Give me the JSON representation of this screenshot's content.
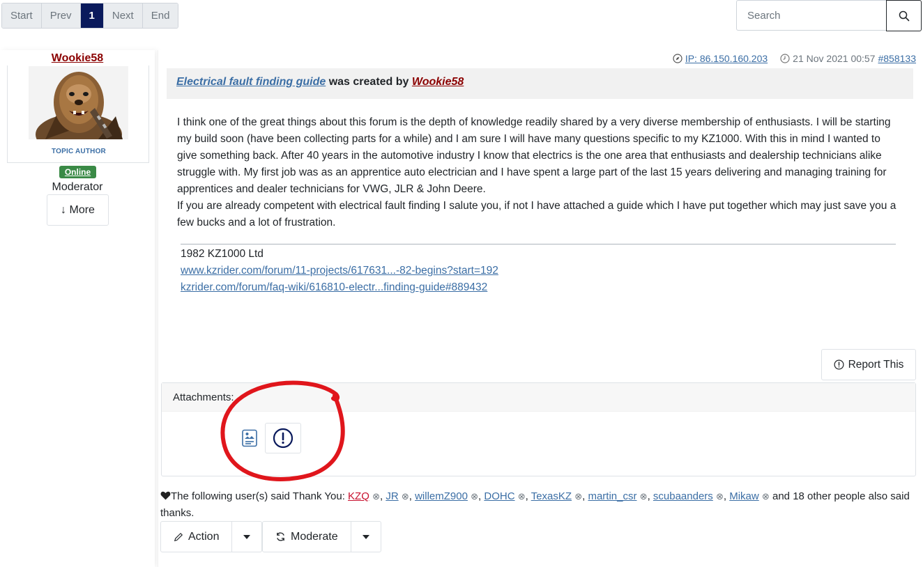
{
  "pagination": {
    "start": "Start",
    "prev": "Prev",
    "current": "1",
    "next": "Next",
    "end": "End"
  },
  "search": {
    "placeholder": "Search"
  },
  "profile": {
    "username": "Wookie58",
    "badge": "TOPIC AUTHOR",
    "status": "Online",
    "role": "Moderator",
    "more_label": "↓ More"
  },
  "post": {
    "ip_label": "IP: 86.150.160.203",
    "date": "21 Nov 2021 00:57",
    "post_id": "#858133",
    "subject_title": "Electrical fault finding guide",
    "subject_mid": "was created by",
    "subject_author": "Wookie58",
    "body_p1": "I think one of the great things about this forum is the depth of knowledge readily shared by a very diverse membership of enthusiasts. I will be starting my build soon (have been collecting parts for a while) and I am sure I will have many questions specific to my KZ1000. With this in mind I wanted to give something back. After 40 years in the automotive industry I know that electrics is the one area that enthusiasts and dealership technicians alike struggle with. My first job was as an apprentice auto electrician and I have spent a large part of the last 15 years delivering and managing training for apprentices and dealer technicians for VWG, JLR & John Deere.",
    "body_p2": "If you are already competent with electrical fault finding I salute you, if not I have attached a guide which I have put together which may just save you a few bucks and a lot of frustration.",
    "signature": {
      "line1": "1982 KZ1000 Ltd",
      "link1": "www.kzrider.com/forum/11-projects/617631...-82-begins?start=192",
      "link2": "kzrider.com/forum/faq-wiki/616810-electr...finding-guide#889432"
    },
    "report_label": "Report This",
    "attachments_label": "Attachments:"
  },
  "thanks": {
    "prefix": "The following user(s) said Thank You:",
    "users": [
      "KZQ",
      "JR",
      "willemZ900",
      "DOHC",
      "TexasKZ",
      "martin_csr",
      "scubaanders",
      "Mikaw"
    ],
    "suffix": "and 18 other people also said thanks."
  },
  "actions": {
    "action_label": "Action",
    "moderate_label": "Moderate"
  },
  "colors": {
    "accent": "#3b6ea5",
    "username": "#8b0000",
    "online": "#3a8a46",
    "pager_active": "#0a1a5c",
    "annotation": "#e0161c"
  }
}
